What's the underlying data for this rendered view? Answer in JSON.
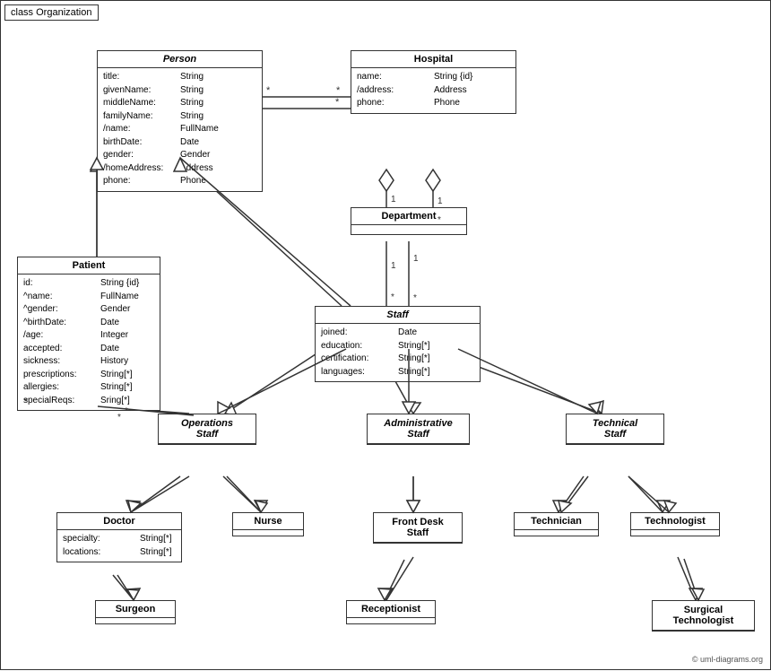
{
  "diagram": {
    "title": "class Organization",
    "copyright": "© uml-diagrams.org"
  },
  "classes": {
    "person": {
      "name": "Person",
      "italic": true,
      "attrs": [
        {
          "name": "title:",
          "type": "String"
        },
        {
          "name": "givenName:",
          "type": "String"
        },
        {
          "name": "middleName:",
          "type": "String"
        },
        {
          "name": "familyName:",
          "type": "String"
        },
        {
          "name": "/name:",
          "type": "FullName"
        },
        {
          "name": "birthDate:",
          "type": "Date"
        },
        {
          "name": "gender:",
          "type": "Gender"
        },
        {
          "name": "/homeAddress:",
          "type": "Address"
        },
        {
          "name": "phone:",
          "type": "Phone"
        }
      ]
    },
    "hospital": {
      "name": "Hospital",
      "italic": false,
      "attrs": [
        {
          "name": "name:",
          "type": "String {id}"
        },
        {
          "name": "/address:",
          "type": "Address"
        },
        {
          "name": "phone:",
          "type": "Phone"
        }
      ]
    },
    "patient": {
      "name": "Patient",
      "italic": false,
      "attrs": [
        {
          "name": "id:",
          "type": "String {id}"
        },
        {
          "name": "^name:",
          "type": "FullName"
        },
        {
          "name": "^gender:",
          "type": "Gender"
        },
        {
          "name": "^birthDate:",
          "type": "Date"
        },
        {
          "name": "/age:",
          "type": "Integer"
        },
        {
          "name": "accepted:",
          "type": "Date"
        },
        {
          "name": "sickness:",
          "type": "History"
        },
        {
          "name": "prescriptions:",
          "type": "String[*]"
        },
        {
          "name": "allergies:",
          "type": "String[*]"
        },
        {
          "name": "specialReqs:",
          "type": "Sring[*]"
        }
      ]
    },
    "department": {
      "name": "Department",
      "italic": false,
      "attrs": []
    },
    "staff": {
      "name": "Staff",
      "italic": true,
      "attrs": [
        {
          "name": "joined:",
          "type": "Date"
        },
        {
          "name": "education:",
          "type": "String[*]"
        },
        {
          "name": "certification:",
          "type": "String[*]"
        },
        {
          "name": "languages:",
          "type": "String[*]"
        }
      ]
    },
    "operations_staff": {
      "name": "Operations Staff",
      "italic": true
    },
    "administrative_staff": {
      "name": "Administrative Staff",
      "italic": true
    },
    "technical_staff": {
      "name": "Technical Staff",
      "italic": true
    },
    "doctor": {
      "name": "Doctor",
      "italic": false,
      "attrs": [
        {
          "name": "specialty:",
          "type": "String[*]"
        },
        {
          "name": "locations:",
          "type": "String[*]"
        }
      ]
    },
    "nurse": {
      "name": "Nurse",
      "italic": false,
      "attrs": []
    },
    "front_desk_staff": {
      "name": "Front Desk Staff",
      "italic": false,
      "attrs": []
    },
    "technician": {
      "name": "Technician",
      "italic": false,
      "attrs": []
    },
    "technologist": {
      "name": "Technologist",
      "italic": false,
      "attrs": []
    },
    "surgeon": {
      "name": "Surgeon",
      "italic": false,
      "attrs": []
    },
    "receptionist": {
      "name": "Receptionist",
      "italic": false,
      "attrs": []
    },
    "surgical_technologist": {
      "name": "Surgical Technologist",
      "italic": false,
      "attrs": []
    }
  }
}
